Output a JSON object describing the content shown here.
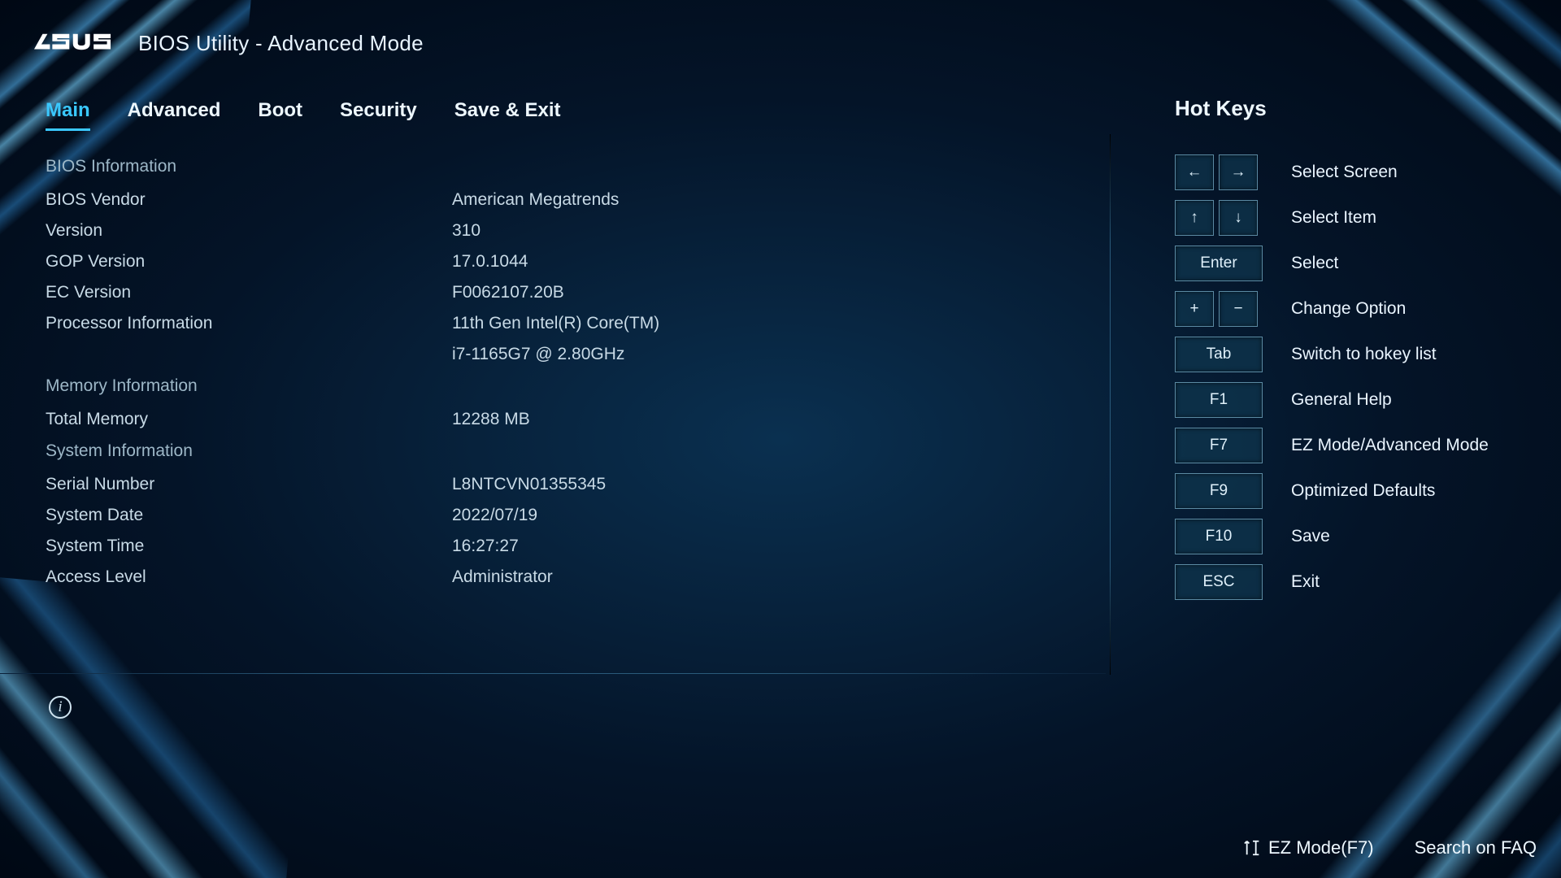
{
  "header": {
    "brand": "ASUS",
    "title": "BIOS Utility - Advanced Mode"
  },
  "tabs": [
    {
      "id": "main",
      "label": "Main",
      "active": true
    },
    {
      "id": "advanced",
      "label": "Advanced",
      "active": false
    },
    {
      "id": "boot",
      "label": "Boot",
      "active": false
    },
    {
      "id": "security",
      "label": "Security",
      "active": false
    },
    {
      "id": "save-exit",
      "label": "Save & Exit",
      "active": false
    }
  ],
  "sections": {
    "bios_info_title": "BIOS Information",
    "bios_info": [
      {
        "label": "BIOS Vendor",
        "value": "American Megatrends"
      },
      {
        "label": "Version",
        "value": "310"
      },
      {
        "label": "GOP Version",
        "value": "17.0.1044"
      },
      {
        "label": "EC Version",
        "value": "F0062107.20B"
      },
      {
        "label": "Processor Information",
        "value": "11th Gen Intel(R) Core(TM)\ni7-1165G7 @ 2.80GHz"
      }
    ],
    "mem_info_title": "Memory Information",
    "mem_info": [
      {
        "label": "Total Memory",
        "value": "12288 MB"
      }
    ],
    "sys_info_title": "System Information",
    "sys_info": [
      {
        "label": "Serial Number",
        "value": "L8NTCVN01355345"
      },
      {
        "label": "System Date",
        "value": "2022/07/19"
      },
      {
        "label": "System Time",
        "value": "16:27:27"
      },
      {
        "label": "Access Level",
        "value": "Administrator"
      }
    ]
  },
  "hotkeys": {
    "title": "Hot Keys",
    "rows": [
      {
        "keys": [
          "←",
          "→"
        ],
        "desc": "Select Screen"
      },
      {
        "keys": [
          "↑",
          "↓"
        ],
        "desc": "Select Item"
      },
      {
        "keys": [
          "Enter"
        ],
        "desc": "Select",
        "wide": true
      },
      {
        "keys": [
          "+",
          "−"
        ],
        "desc": "Change Option"
      },
      {
        "keys": [
          "Tab"
        ],
        "desc": "Switch to hokey list",
        "wide": true
      },
      {
        "keys": [
          "F1"
        ],
        "desc": "General Help",
        "wide": true
      },
      {
        "keys": [
          "F7"
        ],
        "desc": "EZ Mode/Advanced Mode",
        "wide": true
      },
      {
        "keys": [
          "F9"
        ],
        "desc": "Optimized Defaults",
        "wide": true
      },
      {
        "keys": [
          "F10"
        ],
        "desc": "Save",
        "wide": true
      },
      {
        "keys": [
          "ESC"
        ],
        "desc": "Exit",
        "wide": true
      }
    ]
  },
  "footer": {
    "ez_mode": "EZ Mode(F7)",
    "faq": "Search on FAQ"
  }
}
